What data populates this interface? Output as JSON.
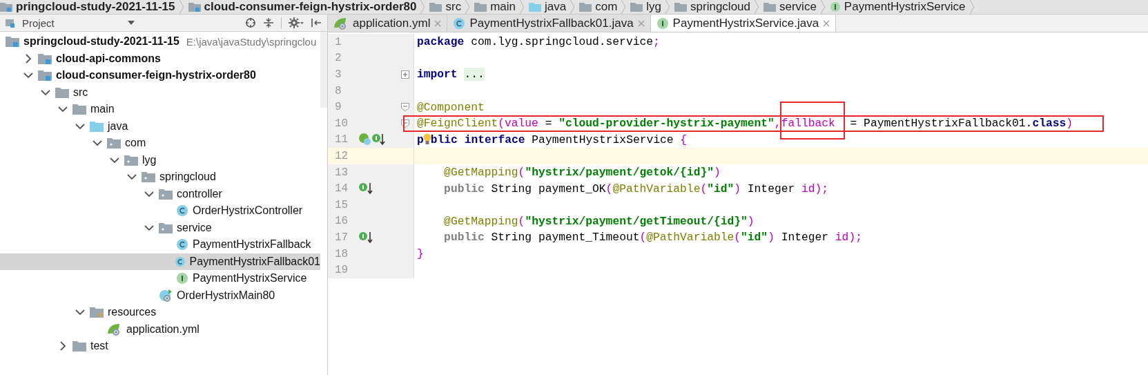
{
  "breadcrumbs": [
    {
      "label": "pringcloud-study-2021-11-15",
      "kind": "module"
    },
    {
      "label": "cloud-consumer-feign-hystrix-order80",
      "kind": "module"
    },
    {
      "label": "src",
      "kind": "folder"
    },
    {
      "label": "main",
      "kind": "folder"
    },
    {
      "label": "java",
      "kind": "source"
    },
    {
      "label": "com",
      "kind": "package"
    },
    {
      "label": "lyg",
      "kind": "package"
    },
    {
      "label": "springcloud",
      "kind": "package"
    },
    {
      "label": "service",
      "kind": "package"
    },
    {
      "label": "PaymentHystrixService",
      "kind": "interface"
    }
  ],
  "project_panel": {
    "title": "Project",
    "tree": [
      {
        "label": "springcloud-study-2021-11-15",
        "path": "E:\\java\\javaStudy\\springclou",
        "kind": "module",
        "selected": false,
        "children": [
          {
            "label": "cloud-api-commons",
            "kind": "module",
            "expanded": false,
            "selected": false
          },
          {
            "label": "cloud-consumer-feign-hystrix-order80",
            "kind": "module",
            "expanded": true,
            "selected": false,
            "children": [
              {
                "label": "src",
                "kind": "folder",
                "expanded": true,
                "selected": false,
                "children": [
                  {
                    "label": "main",
                    "kind": "folder",
                    "expanded": true,
                    "selected": false,
                    "children": [
                      {
                        "label": "java",
                        "kind": "source",
                        "expanded": true,
                        "selected": false,
                        "children": [
                          {
                            "label": "com",
                            "kind": "package",
                            "expanded": true,
                            "selected": false,
                            "children": [
                              {
                                "label": "lyg",
                                "kind": "package",
                                "expanded": true,
                                "selected": false,
                                "children": [
                                  {
                                    "label": "springcloud",
                                    "kind": "package",
                                    "expanded": true,
                                    "selected": false,
                                    "children": [
                                      {
                                        "label": "controller",
                                        "kind": "package",
                                        "expanded": true,
                                        "selected": false,
                                        "children": [
                                          {
                                            "label": "OrderHystrixController",
                                            "kind": "class",
                                            "selected": false
                                          }
                                        ]
                                      },
                                      {
                                        "label": "service",
                                        "kind": "package",
                                        "expanded": true,
                                        "selected": false,
                                        "children": [
                                          {
                                            "label": "PaymentHystrixFallback",
                                            "kind": "class",
                                            "selected": false
                                          },
                                          {
                                            "label": "PaymentHystrixFallback01",
                                            "kind": "class",
                                            "selected": true
                                          },
                                          {
                                            "label": "PaymentHystrixService",
                                            "kind": "interface",
                                            "selected": false
                                          }
                                        ]
                                      },
                                      {
                                        "label": "OrderHystrixMain80",
                                        "kind": "spring-class",
                                        "selected": false
                                      }
                                    ]
                                  }
                                ]
                              }
                            ]
                          }
                        ]
                      },
                      {
                        "label": "resources",
                        "kind": "resources",
                        "expanded": true,
                        "selected": false,
                        "children": [
                          {
                            "label": "application.yml",
                            "kind": "yml",
                            "selected": false
                          }
                        ]
                      }
                    ]
                  },
                  {
                    "label": "test",
                    "kind": "folder",
                    "expanded": false,
                    "selected": false
                  }
                ]
              }
            ]
          }
        ]
      }
    ]
  },
  "tabs": [
    {
      "label": "application.yml",
      "kind": "yml",
      "selected": false
    },
    {
      "label": "PaymentHystrixFallback01.java",
      "kind": "class",
      "selected": false
    },
    {
      "label": "PaymentHystrixService.java",
      "kind": "interface",
      "selected": true
    }
  ],
  "editor": {
    "lines": [
      {
        "number": "1",
        "tokens": [
          {
            "kind": "kw",
            "text": "package"
          },
          {
            "kind": "plain",
            "text": " com.lyg.springcloud.service"
          },
          {
            "kind": "paren",
            "text": ";"
          }
        ]
      },
      {
        "number": "2"
      },
      {
        "number": "3",
        "folded": true,
        "tokens": [
          {
            "kind": "kw",
            "text": "import"
          },
          {
            "kind": "space"
          },
          {
            "kind": "folded",
            "text": "..."
          }
        ]
      },
      {
        "number": "8"
      },
      {
        "number": "9",
        "folded": false,
        "tokens": [
          {
            "kind": "ann",
            "text": "@Component"
          }
        ]
      },
      {
        "number": "10",
        "folded": false,
        "boxed": true,
        "tokens": [
          {
            "kind": "ann",
            "text": "@FeignClient"
          },
          {
            "kind": "paren",
            "text": "("
          },
          {
            "kind": "param",
            "text": "value"
          },
          {
            "kind": "plain",
            "text": " = "
          },
          {
            "kind": "str",
            "text": "\"cloud-provider-hystrix-payment\""
          },
          {
            "kind": "paren",
            "text": ","
          },
          {
            "kind": "param",
            "text": "fallback",
            "boxed": true
          },
          {
            "kind": "plain",
            "text": " = PaymentHystrixFallback01."
          },
          {
            "kind": "kw",
            "text": "class"
          },
          {
            "kind": "paren",
            "text": ")"
          }
        ]
      },
      {
        "number": "11",
        "gutter_icons": [
          {
            "kind": "overridden"
          }
        ],
        "tokens": [
          {
            "kind": "kw",
            "text": "p"
          },
          {
            "kind": "bulb"
          },
          {
            "kind": "kw",
            "text": "blic"
          },
          {
            "kind": "space"
          },
          {
            "kind": "kw",
            "text": "interface"
          },
          {
            "kind": "plain",
            "text": " PaymentHystrixService "
          },
          {
            "kind": "paren",
            "text": "{"
          }
        ]
      },
      {
        "number": "12",
        "current": true
      },
      {
        "number": "13",
        "tokens": [
          {
            "kind": "indent"
          },
          {
            "kind": "ann",
            "text": "@GetMapping"
          },
          {
            "kind": "paren",
            "text": "("
          },
          {
            "kind": "str",
            "text": "\"hystrix/payment/getok/{id}\""
          },
          {
            "kind": "paren",
            "text": ")"
          }
        ]
      },
      {
        "number": "14",
        "gutter_icons": [
          {
            "kind": "implemented"
          }
        ],
        "tokens": [
          {
            "kind": "indent"
          },
          {
            "kind": "dim",
            "text": "public"
          },
          {
            "kind": "plain",
            "text": " String payment_OK"
          },
          {
            "kind": "paren",
            "text": "("
          },
          {
            "kind": "ann",
            "text": "@PathVariable"
          },
          {
            "kind": "paren",
            "text": "("
          },
          {
            "kind": "str",
            "text": "\"id\""
          },
          {
            "kind": "paren",
            "text": ")"
          },
          {
            "kind": "plain",
            "text": " Integer "
          },
          {
            "kind": "param",
            "text": "id"
          },
          {
            "kind": "paren",
            "text": ");"
          }
        ]
      },
      {
        "number": "15"
      },
      {
        "number": "16",
        "tokens": [
          {
            "kind": "indent"
          },
          {
            "kind": "ann",
            "text": "@GetMapping"
          },
          {
            "kind": "paren",
            "text": "("
          },
          {
            "kind": "str",
            "text": "\"hystrix/payment/getTimeout/{id}\""
          },
          {
            "kind": "paren",
            "text": ")"
          }
        ]
      },
      {
        "number": "17",
        "gutter_icons": [
          {
            "kind": "implemented"
          }
        ],
        "tokens": [
          {
            "kind": "indent"
          },
          {
            "kind": "dim",
            "text": "public"
          },
          {
            "kind": "plain",
            "text": " String payment_Timeout"
          },
          {
            "kind": "paren",
            "text": "("
          },
          {
            "kind": "ann",
            "text": "@PathVariable"
          },
          {
            "kind": "paren",
            "text": "("
          },
          {
            "kind": "str",
            "text": "\"id\""
          },
          {
            "kind": "paren",
            "text": ")"
          },
          {
            "kind": "plain",
            "text": " Integer "
          },
          {
            "kind": "param",
            "text": "id"
          },
          {
            "kind": "paren",
            "text": ");"
          }
        ]
      },
      {
        "number": "18",
        "tokens": [
          {
            "kind": "paren",
            "text": "}"
          }
        ]
      },
      {
        "number": "19"
      }
    ]
  }
}
